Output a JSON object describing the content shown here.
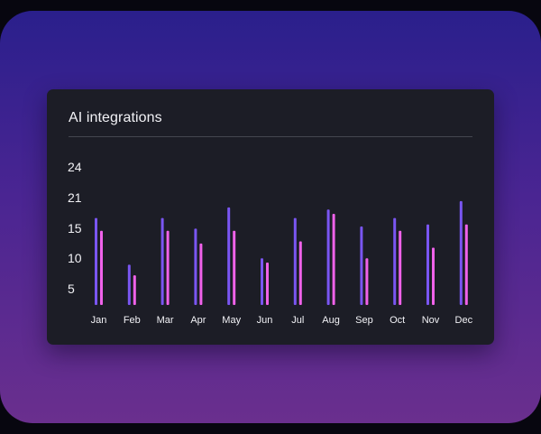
{
  "card": {
    "title": "AI integrations"
  },
  "colors": {
    "series_a": "#7a56f2",
    "series_b": "#f062ea",
    "card_bg": "#1c1d26",
    "text": "#f2f2f6",
    "divider": "#44464f"
  },
  "chart_data": {
    "type": "bar",
    "title": "AI integrations",
    "xlabel": "",
    "ylabel": "",
    "categories": [
      "Jan",
      "Feb",
      "Mar",
      "Apr",
      "May",
      "Jun",
      "Jul",
      "Aug",
      "Sep",
      "Oct",
      "Nov",
      "Dec"
    ],
    "yticks": [
      "24",
      "21",
      "15",
      "10",
      "5"
    ],
    "series": [
      {
        "values": [
          20.5,
          9.5,
          20.5,
          18,
          23,
          11,
          20.5,
          22.5,
          18.5,
          20.5,
          19,
          24.5
        ]
      },
      {
        "values": [
          17.5,
          7,
          17.5,
          14.5,
          17.5,
          10,
          15,
          21.5,
          11,
          17.5,
          13.5,
          19
        ]
      }
    ],
    "legend": false,
    "grid": false
  }
}
